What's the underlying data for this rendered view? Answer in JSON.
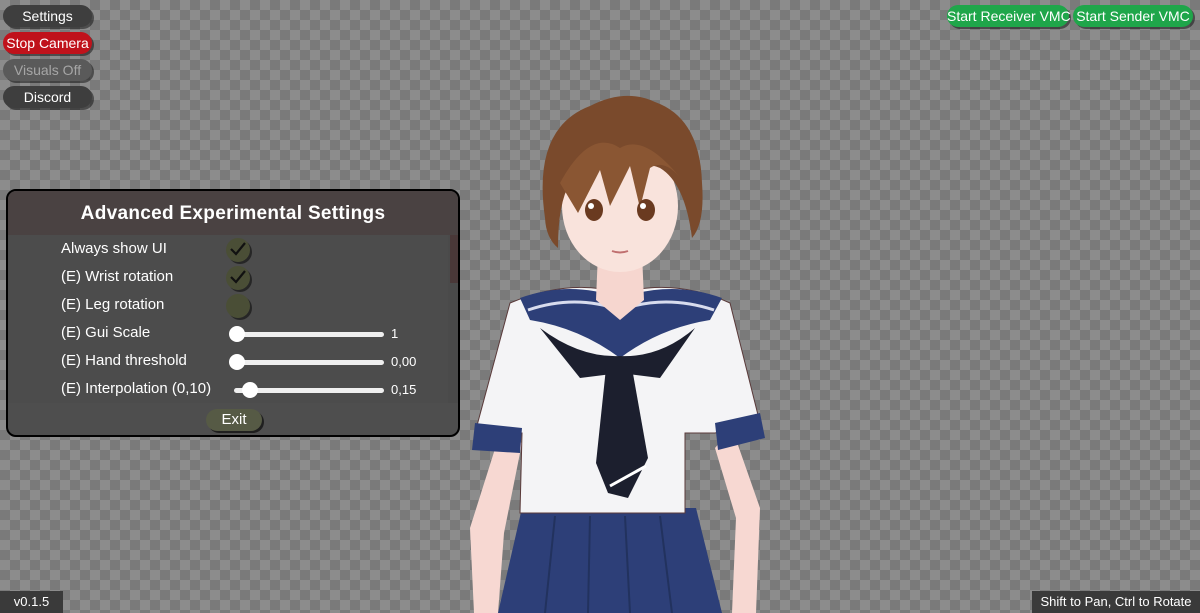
{
  "buttons": {
    "settings": "Settings",
    "stop_camera": "Stop Camera",
    "visuals_off": "Visuals Off",
    "discord": "Discord",
    "start_receiver": "Start Receiver VMC",
    "start_sender": "Start Sender VMC"
  },
  "panel": {
    "title": "Advanced Experimental Settings",
    "rows": [
      {
        "label": "Always show UI",
        "type": "checkbox",
        "checked": true
      },
      {
        "label": "(E) Wrist rotation",
        "type": "checkbox",
        "checked": true
      },
      {
        "label": "(E) Leg rotation",
        "type": "checkbox",
        "checked": false
      },
      {
        "label": "(E) Gui Scale",
        "type": "slider",
        "value": "1",
        "fraction": 0.0
      },
      {
        "label": "(E) Hand threshold",
        "type": "slider",
        "value": "0,00",
        "fraction": 0.0
      },
      {
        "label": "(E) Interpolation (0,10)",
        "type": "slider",
        "value": "0,15",
        "fraction": 0.1
      }
    ],
    "exit": "Exit"
  },
  "footer": {
    "version": "v0.1.5",
    "hint": "Shift to Pan, Ctrl to Rotate"
  },
  "colors": {
    "stop_camera": "#c0121b",
    "vmc_buttons": "#1fa64a",
    "panel_header": "#4a4242"
  },
  "icons": [
    "checkmark-icon",
    "slider-knob"
  ]
}
